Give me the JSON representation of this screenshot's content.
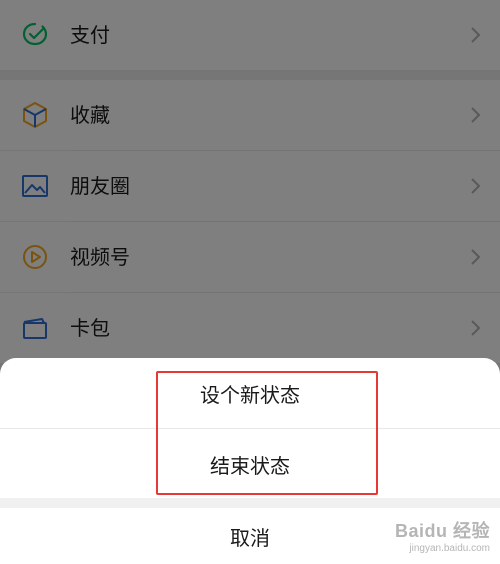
{
  "menu": {
    "items": [
      {
        "label": "支付",
        "icon": "wechat-pay-icon"
      },
      {
        "label": "收藏",
        "icon": "favorites-cube-icon"
      },
      {
        "label": "朋友圈",
        "icon": "moments-photo-icon"
      },
      {
        "label": "视频号",
        "icon": "channels-play-icon"
      },
      {
        "label": "卡包",
        "icon": "card-wallet-icon"
      }
    ]
  },
  "action_sheet": {
    "options": [
      {
        "label": "设个新状态"
      },
      {
        "label": "结束状态"
      }
    ],
    "cancel_label": "取消"
  },
  "watermark": {
    "main": "Baidu 经验",
    "sub": "jingyan.baidu.com"
  },
  "colors": {
    "highlight_border": "#e53935",
    "overlay": "rgba(0,0,0,0.5)",
    "pay_icon": "#07c160",
    "favorites_icon": "#f5a623",
    "moments_icon": "#2f6fd6",
    "channels_icon": "#f5a623",
    "card_icon": "#2f6fd6"
  }
}
